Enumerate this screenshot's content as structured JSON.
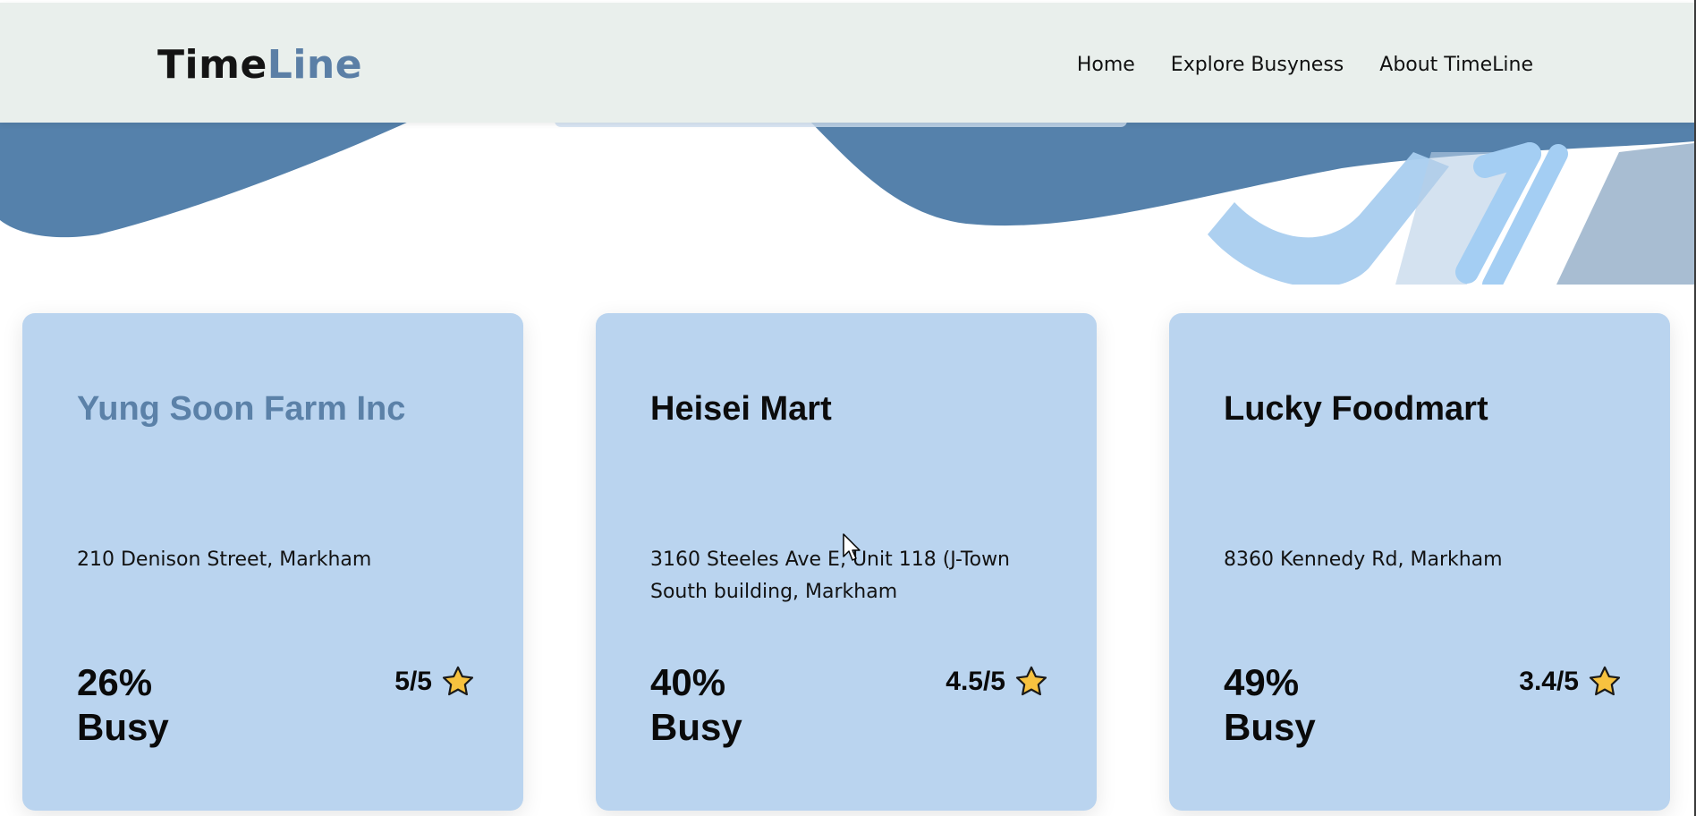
{
  "brand": {
    "logo_part1": "Time",
    "logo_part2": "Line",
    "colors": {
      "dark": "#141414",
      "accent": "#5b7fa6",
      "nav_bg": "#e9efec",
      "card_bg": "#bad4ef",
      "wave": "#5581ab",
      "star": "#f7c23f"
    }
  },
  "nav": {
    "items": [
      {
        "label": "Home"
      },
      {
        "label": "Explore Busyness"
      },
      {
        "label": "About TimeLine"
      }
    ]
  },
  "cards": [
    {
      "name": "Yung Soon Farm Inc",
      "address": "210 Denison Street, Markham",
      "busy_percent": "26%",
      "busy_label": "Busy",
      "rating": "5/5",
      "icon": "star-icon"
    },
    {
      "name": "Heisei Mart",
      "address": "3160 Steeles Ave E, Unit 118 (J-Town South building, Markham",
      "busy_percent": "40%",
      "busy_label": "Busy",
      "rating": "4.5/5",
      "icon": "star-icon"
    },
    {
      "name": "Lucky Foodmart",
      "address": "8360 Kennedy Rd, Markham",
      "busy_percent": "49%",
      "busy_label": "Busy",
      "rating": "3.4/5",
      "icon": "star-icon"
    }
  ]
}
